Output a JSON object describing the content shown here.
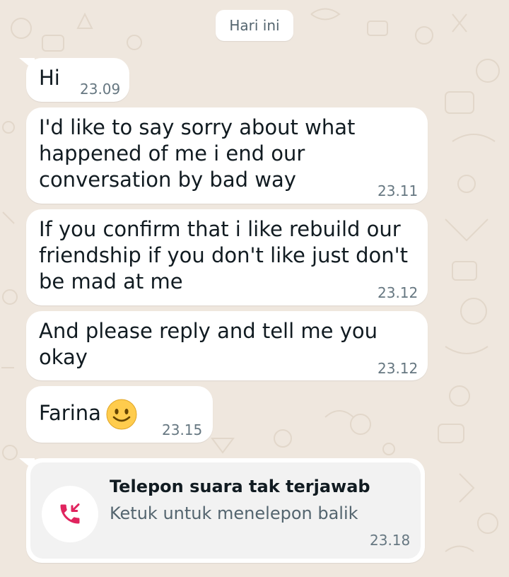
{
  "date_divider": "Hari ini",
  "messages": [
    {
      "text": "Hi",
      "time": "23.09"
    },
    {
      "text": "I'd like to say sorry about what\nhappened of me i end our\nconversation by bad way",
      "time": "23.11"
    },
    {
      "text": "If you confirm that i like rebuild our\nfriendship if you don't like just don't\nbe mad at me",
      "time": "23.12"
    },
    {
      "text": "And please reply and tell me you\nokay",
      "time": "23.12"
    },
    {
      "text": "Farina",
      "emoji": "smiling-face-emoji",
      "time": "23.15"
    }
  ],
  "missed_call": {
    "icon": "missed-voice-call-icon",
    "title": "Telepon suara tak terjawab",
    "subtitle": "Ketuk untuk menelepon balik",
    "time": "23.18",
    "accent_color": "#e0245e"
  },
  "colors": {
    "wallpaper": "#efe7de",
    "bubble": "#ffffff",
    "text": "#111b21",
    "meta": "#667781"
  }
}
